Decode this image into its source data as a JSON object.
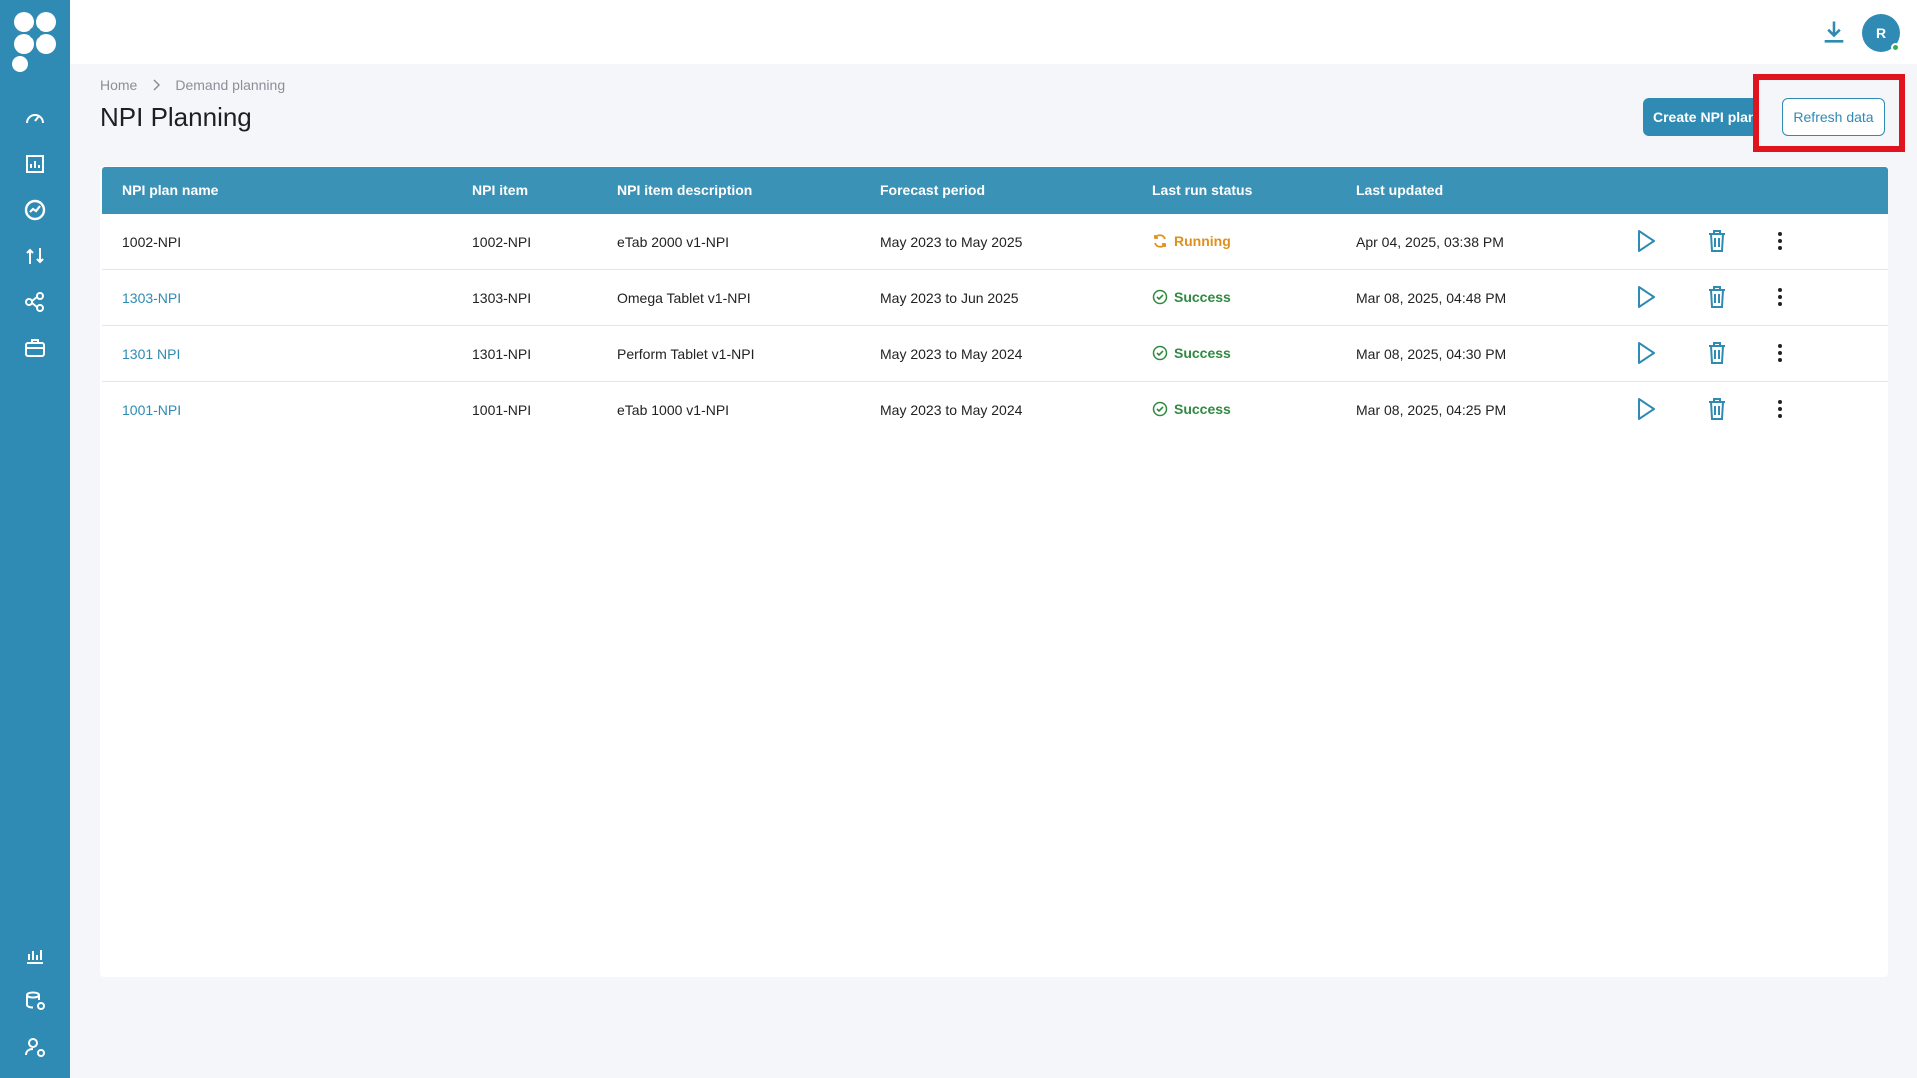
{
  "colors": {
    "primary": "#2f8bb3",
    "table_header": "#3a93b7",
    "running": "#e0901c",
    "success": "#2f8a3f",
    "highlight": "#e0141e"
  },
  "sidebar": {
    "logo_icon": "flower-logo-icon",
    "top_items": [
      {
        "icon": "speedometer-icon"
      },
      {
        "icon": "bar-report-icon"
      },
      {
        "icon": "trend-chart-icon",
        "active": true
      },
      {
        "icon": "route-icon"
      },
      {
        "icon": "network-icon"
      },
      {
        "icon": "briefcase-icon"
      }
    ],
    "bottom_items": [
      {
        "icon": "analytics-icon"
      },
      {
        "icon": "database-settings-icon"
      },
      {
        "icon": "user-settings-icon"
      }
    ]
  },
  "header": {
    "avatar_initial": "R",
    "download_icon": "download-icon"
  },
  "breadcrumb": {
    "home": "Home",
    "current": "Demand planning"
  },
  "page": {
    "title": "NPI Planning",
    "create_button": "Create NPI plan",
    "refresh_button": "Refresh data"
  },
  "table": {
    "columns": [
      "NPI plan name",
      "NPI item",
      "NPI item description",
      "Forecast period",
      "Last run status",
      "Last updated"
    ],
    "rows": [
      {
        "name": "1002-NPI",
        "is_link": false,
        "item": "1002-NPI",
        "description": "eTab 2000 v1-NPI",
        "period": "May 2023 to May 2025",
        "status": "Running",
        "updated": "Apr 04, 2025, 03:38 PM"
      },
      {
        "name": "1303-NPI",
        "is_link": true,
        "item": "1303-NPI",
        "description": "Omega Tablet v1-NPI",
        "period": "May 2023 to Jun 2025",
        "status": "Success",
        "updated": "Mar 08, 2025, 04:48 PM"
      },
      {
        "name": "1301 NPI",
        "is_link": true,
        "item": "1301-NPI",
        "description": "Perform Tablet v1-NPI",
        "period": "May 2023 to May 2024",
        "status": "Success",
        "updated": "Mar 08, 2025, 04:30 PM"
      },
      {
        "name": "1001-NPI",
        "is_link": true,
        "item": "1001-NPI",
        "description": "eTab 1000 v1-NPI",
        "period": "May 2023 to May 2024",
        "status": "Success",
        "updated": "Mar 08, 2025, 04:25 PM"
      }
    ]
  }
}
